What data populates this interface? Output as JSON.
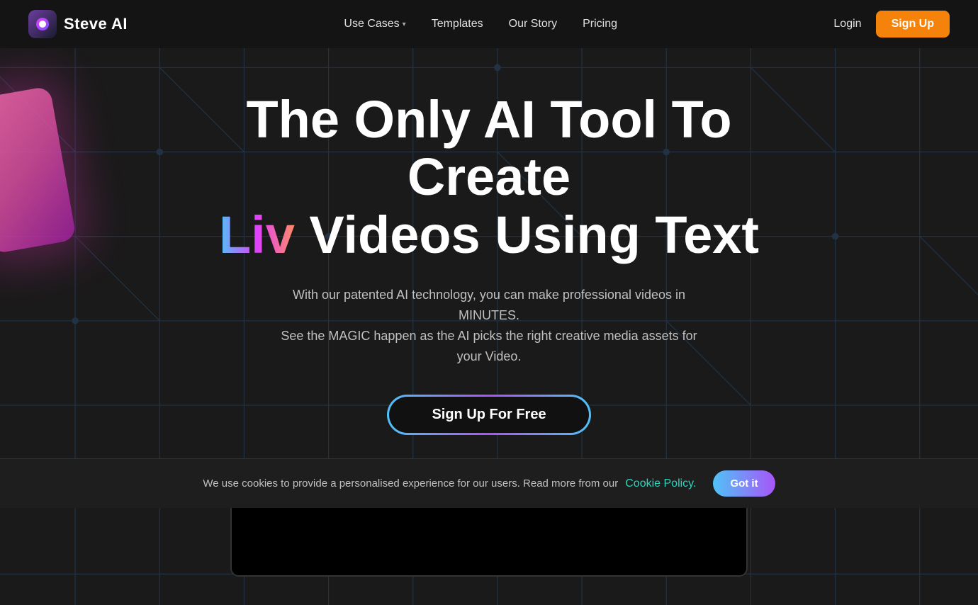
{
  "brand": {
    "name": "Steve AI",
    "logo_alt": "Steve AI Logo"
  },
  "navbar": {
    "use_cases_label": "Use Cases",
    "templates_label": "Templates",
    "our_story_label": "Our Story",
    "pricing_label": "Pricing",
    "login_label": "Login",
    "signup_label": "Sign Up"
  },
  "hero": {
    "title_part1": "The Only AI Tool To Create",
    "title_liv": "Liv",
    "title_part2": "Videos Using Text",
    "subtitle_line1": "With our patented AI technology, you can make professional videos in MINUTES.",
    "subtitle_line2": "See the MAGIC happen as the AI picks the right creative media assets for your Video.",
    "cta_label": "Sign Up For Free"
  },
  "cookie": {
    "message": "We use cookies to provide a personalised experience for our users. Read more from our",
    "link_text": "Cookie Policy.",
    "got_it_label": "Got it"
  }
}
